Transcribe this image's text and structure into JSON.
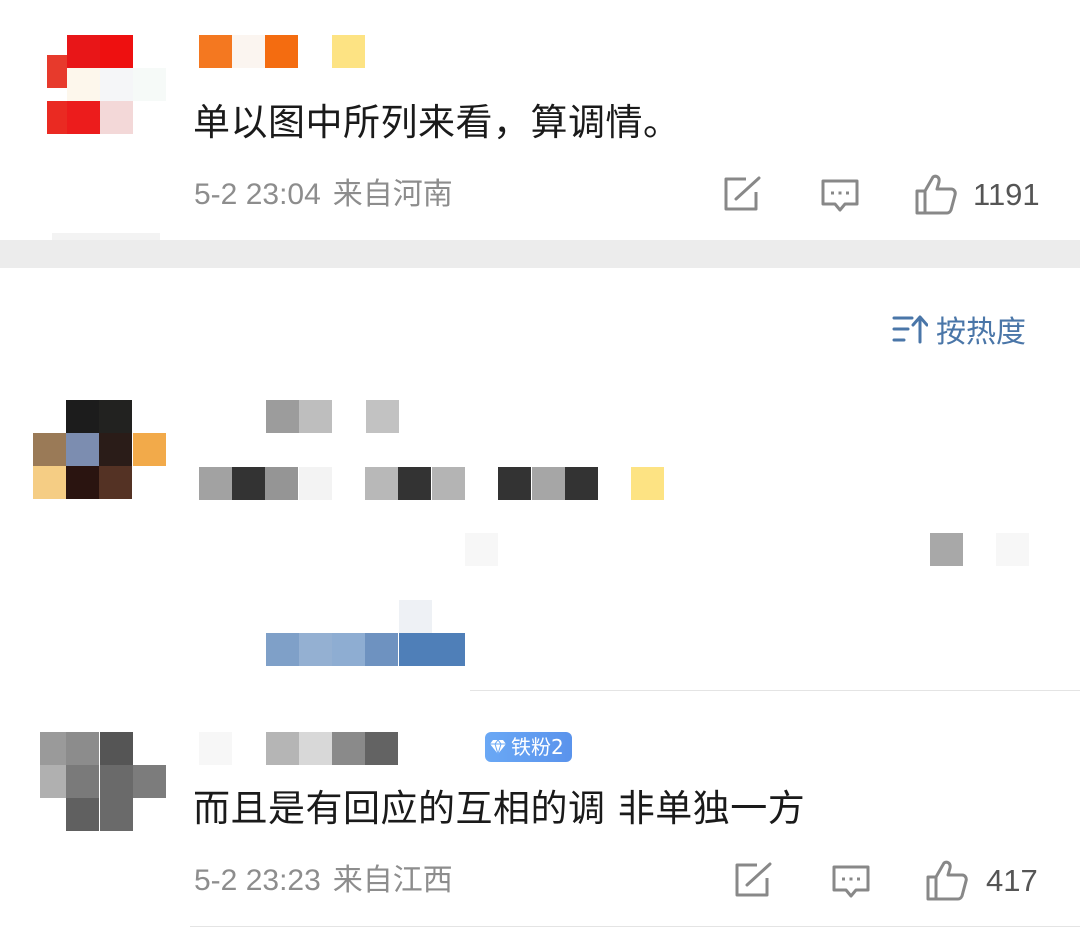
{
  "comments": [
    {
      "text": "单以图中所列来看，算调情。",
      "time": "5-2 23:04",
      "location": "来自河南",
      "likes": "1191"
    },
    {
      "text": "而且是有回应的互相的调 非单独一方",
      "time": "5-2 23:23",
      "location": "来自江西",
      "likes": "417",
      "badge": "铁粉2"
    }
  ],
  "sort": {
    "label": "按热度",
    "icon": "sort-icon"
  },
  "icons": {
    "share": "share-icon",
    "reply": "comment-icon",
    "like": "thumbs-up-icon"
  },
  "colors": {
    "accent": "#4a76a8",
    "meta": "#8d8d8d",
    "badge": "#5a93ec"
  }
}
